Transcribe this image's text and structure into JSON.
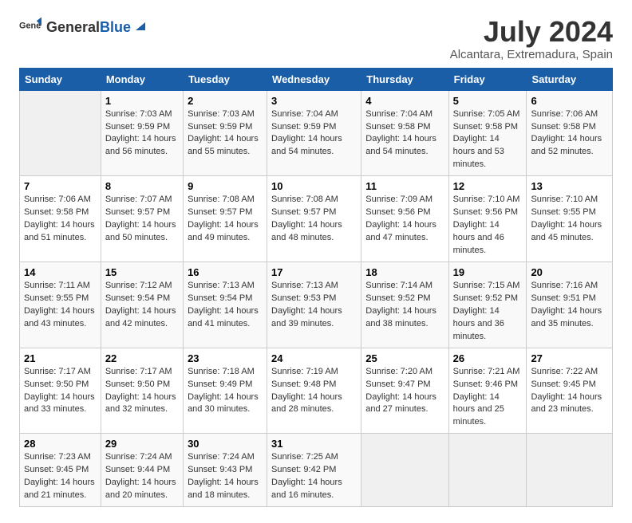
{
  "logo": {
    "text_general": "General",
    "text_blue": "Blue"
  },
  "title": "July 2024",
  "subtitle": "Alcantara, Extremadura, Spain",
  "days_header": [
    "Sunday",
    "Monday",
    "Tuesday",
    "Wednesday",
    "Thursday",
    "Friday",
    "Saturday"
  ],
  "weeks": [
    [
      {
        "day": "",
        "empty": true
      },
      {
        "day": "1",
        "sunrise": "Sunrise: 7:03 AM",
        "sunset": "Sunset: 9:59 PM",
        "daylight": "Daylight: 14 hours and 56 minutes."
      },
      {
        "day": "2",
        "sunrise": "Sunrise: 7:03 AM",
        "sunset": "Sunset: 9:59 PM",
        "daylight": "Daylight: 14 hours and 55 minutes."
      },
      {
        "day": "3",
        "sunrise": "Sunrise: 7:04 AM",
        "sunset": "Sunset: 9:59 PM",
        "daylight": "Daylight: 14 hours and 54 minutes."
      },
      {
        "day": "4",
        "sunrise": "Sunrise: 7:04 AM",
        "sunset": "Sunset: 9:58 PM",
        "daylight": "Daylight: 14 hours and 54 minutes."
      },
      {
        "day": "5",
        "sunrise": "Sunrise: 7:05 AM",
        "sunset": "Sunset: 9:58 PM",
        "daylight": "Daylight: 14 hours and 53 minutes."
      },
      {
        "day": "6",
        "sunrise": "Sunrise: 7:06 AM",
        "sunset": "Sunset: 9:58 PM",
        "daylight": "Daylight: 14 hours and 52 minutes."
      }
    ],
    [
      {
        "day": "7",
        "sunrise": "Sunrise: 7:06 AM",
        "sunset": "Sunset: 9:58 PM",
        "daylight": "Daylight: 14 hours and 51 minutes."
      },
      {
        "day": "8",
        "sunrise": "Sunrise: 7:07 AM",
        "sunset": "Sunset: 9:57 PM",
        "daylight": "Daylight: 14 hours and 50 minutes."
      },
      {
        "day": "9",
        "sunrise": "Sunrise: 7:08 AM",
        "sunset": "Sunset: 9:57 PM",
        "daylight": "Daylight: 14 hours and 49 minutes."
      },
      {
        "day": "10",
        "sunrise": "Sunrise: 7:08 AM",
        "sunset": "Sunset: 9:57 PM",
        "daylight": "Daylight: 14 hours and 48 minutes."
      },
      {
        "day": "11",
        "sunrise": "Sunrise: 7:09 AM",
        "sunset": "Sunset: 9:56 PM",
        "daylight": "Daylight: 14 hours and 47 minutes."
      },
      {
        "day": "12",
        "sunrise": "Sunrise: 7:10 AM",
        "sunset": "Sunset: 9:56 PM",
        "daylight": "Daylight: 14 hours and 46 minutes."
      },
      {
        "day": "13",
        "sunrise": "Sunrise: 7:10 AM",
        "sunset": "Sunset: 9:55 PM",
        "daylight": "Daylight: 14 hours and 45 minutes."
      }
    ],
    [
      {
        "day": "14",
        "sunrise": "Sunrise: 7:11 AM",
        "sunset": "Sunset: 9:55 PM",
        "daylight": "Daylight: 14 hours and 43 minutes."
      },
      {
        "day": "15",
        "sunrise": "Sunrise: 7:12 AM",
        "sunset": "Sunset: 9:54 PM",
        "daylight": "Daylight: 14 hours and 42 minutes."
      },
      {
        "day": "16",
        "sunrise": "Sunrise: 7:13 AM",
        "sunset": "Sunset: 9:54 PM",
        "daylight": "Daylight: 14 hours and 41 minutes."
      },
      {
        "day": "17",
        "sunrise": "Sunrise: 7:13 AM",
        "sunset": "Sunset: 9:53 PM",
        "daylight": "Daylight: 14 hours and 39 minutes."
      },
      {
        "day": "18",
        "sunrise": "Sunrise: 7:14 AM",
        "sunset": "Sunset: 9:52 PM",
        "daylight": "Daylight: 14 hours and 38 minutes."
      },
      {
        "day": "19",
        "sunrise": "Sunrise: 7:15 AM",
        "sunset": "Sunset: 9:52 PM",
        "daylight": "Daylight: 14 hours and 36 minutes."
      },
      {
        "day": "20",
        "sunrise": "Sunrise: 7:16 AM",
        "sunset": "Sunset: 9:51 PM",
        "daylight": "Daylight: 14 hours and 35 minutes."
      }
    ],
    [
      {
        "day": "21",
        "sunrise": "Sunrise: 7:17 AM",
        "sunset": "Sunset: 9:50 PM",
        "daylight": "Daylight: 14 hours and 33 minutes."
      },
      {
        "day": "22",
        "sunrise": "Sunrise: 7:17 AM",
        "sunset": "Sunset: 9:50 PM",
        "daylight": "Daylight: 14 hours and 32 minutes."
      },
      {
        "day": "23",
        "sunrise": "Sunrise: 7:18 AM",
        "sunset": "Sunset: 9:49 PM",
        "daylight": "Daylight: 14 hours and 30 minutes."
      },
      {
        "day": "24",
        "sunrise": "Sunrise: 7:19 AM",
        "sunset": "Sunset: 9:48 PM",
        "daylight": "Daylight: 14 hours and 28 minutes."
      },
      {
        "day": "25",
        "sunrise": "Sunrise: 7:20 AM",
        "sunset": "Sunset: 9:47 PM",
        "daylight": "Daylight: 14 hours and 27 minutes."
      },
      {
        "day": "26",
        "sunrise": "Sunrise: 7:21 AM",
        "sunset": "Sunset: 9:46 PM",
        "daylight": "Daylight: 14 hours and 25 minutes."
      },
      {
        "day": "27",
        "sunrise": "Sunrise: 7:22 AM",
        "sunset": "Sunset: 9:45 PM",
        "daylight": "Daylight: 14 hours and 23 minutes."
      }
    ],
    [
      {
        "day": "28",
        "sunrise": "Sunrise: 7:23 AM",
        "sunset": "Sunset: 9:45 PM",
        "daylight": "Daylight: 14 hours and 21 minutes."
      },
      {
        "day": "29",
        "sunrise": "Sunrise: 7:24 AM",
        "sunset": "Sunset: 9:44 PM",
        "daylight": "Daylight: 14 hours and 20 minutes."
      },
      {
        "day": "30",
        "sunrise": "Sunrise: 7:24 AM",
        "sunset": "Sunset: 9:43 PM",
        "daylight": "Daylight: 14 hours and 18 minutes."
      },
      {
        "day": "31",
        "sunrise": "Sunrise: 7:25 AM",
        "sunset": "Sunset: 9:42 PM",
        "daylight": "Daylight: 14 hours and 16 minutes."
      },
      {
        "day": "",
        "empty": true
      },
      {
        "day": "",
        "empty": true
      },
      {
        "day": "",
        "empty": true
      }
    ]
  ]
}
